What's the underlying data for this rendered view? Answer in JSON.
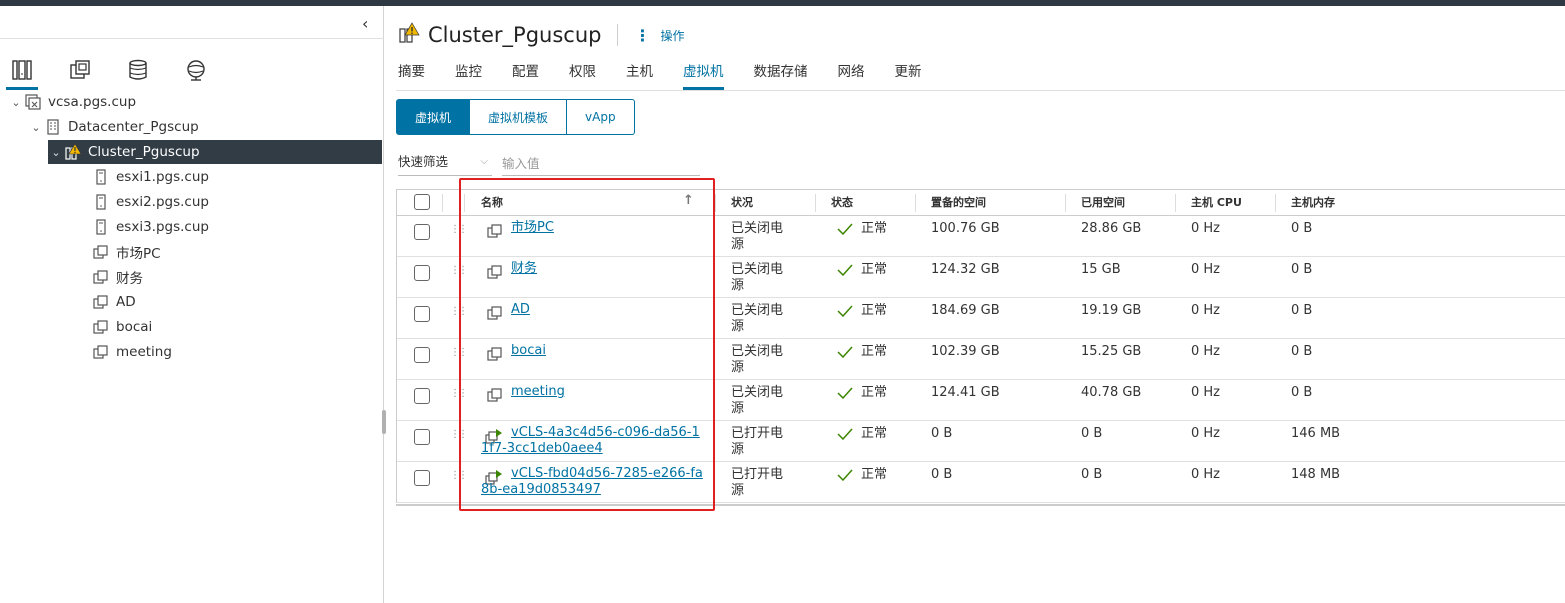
{
  "tree": {
    "root": "vcsa.pgs.cup",
    "datacenter": "Datacenter_Pgscup",
    "cluster": "Cluster_Pguscup",
    "items": [
      "esxi1.pgs.cup",
      "esxi2.pgs.cup",
      "esxi3.pgs.cup",
      "市场PC",
      "财务",
      "AD",
      "bocai",
      "meeting"
    ]
  },
  "header": {
    "title": "Cluster_Pguscup",
    "actions_label": "操作"
  },
  "tabs": [
    "摘要",
    "监控",
    "配置",
    "权限",
    "主机",
    "虚拟机",
    "数据存储",
    "网络",
    "更新"
  ],
  "active_tab": "虚拟机",
  "subtabs": [
    "虚拟机",
    "虚拟机模板",
    "vApp"
  ],
  "filter": {
    "select_value": "快速筛选",
    "input_placeholder": "输入值"
  },
  "grid": {
    "columns": [
      "名称",
      "状况",
      "状态",
      "置备的空间",
      "已用空间",
      "主机 CPU",
      "主机内存"
    ],
    "rows": [
      {
        "name": "市场PC",
        "condition": "已关闭电源",
        "status": "正常",
        "provisioned": "100.76 GB",
        "used": "28.86 GB",
        "cpu": "0 Hz",
        "mem": "0 B"
      },
      {
        "name": "财务",
        "condition": "已关闭电源",
        "status": "正常",
        "provisioned": "124.32 GB",
        "used": "15 GB",
        "cpu": "0 Hz",
        "mem": "0 B"
      },
      {
        "name": "AD",
        "condition": "已关闭电源",
        "status": "正常",
        "provisioned": "184.69 GB",
        "used": "19.19 GB",
        "cpu": "0 Hz",
        "mem": "0 B"
      },
      {
        "name": "bocai",
        "condition": "已关闭电源",
        "status": "正常",
        "provisioned": "102.39 GB",
        "used": "15.25 GB",
        "cpu": "0 Hz",
        "mem": "0 B"
      },
      {
        "name": "meeting",
        "condition": "已关闭电源",
        "status": "正常",
        "provisioned": "124.41 GB",
        "used": "40.78 GB",
        "cpu": "0 Hz",
        "mem": "0 B"
      },
      {
        "name": "vCLS-4a3c4d56-c096-da56-11f7-3cc1deb0aee4",
        "condition": "已打开电源",
        "status": "正常",
        "provisioned": "0 B",
        "used": "0 B",
        "cpu": "0 Hz",
        "mem": "146 MB"
      },
      {
        "name": "vCLS-fbd04d56-7285-e266-fa8b-ea19d0853497",
        "condition": "已打开电源",
        "status": "正常",
        "provisioned": "0 B",
        "used": "0 B",
        "cpu": "0 Hz",
        "mem": "148 MB"
      }
    ]
  },
  "colors": {
    "accent": "#0072a3",
    "highlight_box": "#e02020",
    "ok_check": "#3c8500"
  }
}
